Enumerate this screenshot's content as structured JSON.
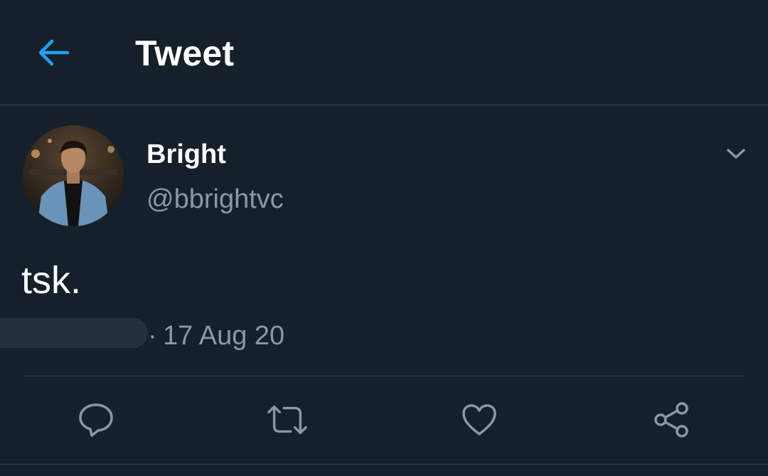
{
  "header": {
    "back_icon": "arrow-left-icon",
    "title": "Tweet"
  },
  "colors": {
    "background": "#15202b",
    "accent": "#1da1f2",
    "secondary_text": "#8899a6",
    "divider": "#38444d"
  },
  "tweet": {
    "author": {
      "display_name": "Bright",
      "handle": "@bbrightvc",
      "avatar": "profile-photo"
    },
    "text": "tsk.",
    "meta": {
      "separator": "·",
      "date": "17 Aug 20"
    }
  },
  "actions": [
    {
      "name": "reply",
      "icon": "reply-icon"
    },
    {
      "name": "retweet",
      "icon": "retweet-icon"
    },
    {
      "name": "like",
      "icon": "heart-icon"
    },
    {
      "name": "share",
      "icon": "share-icon"
    }
  ]
}
